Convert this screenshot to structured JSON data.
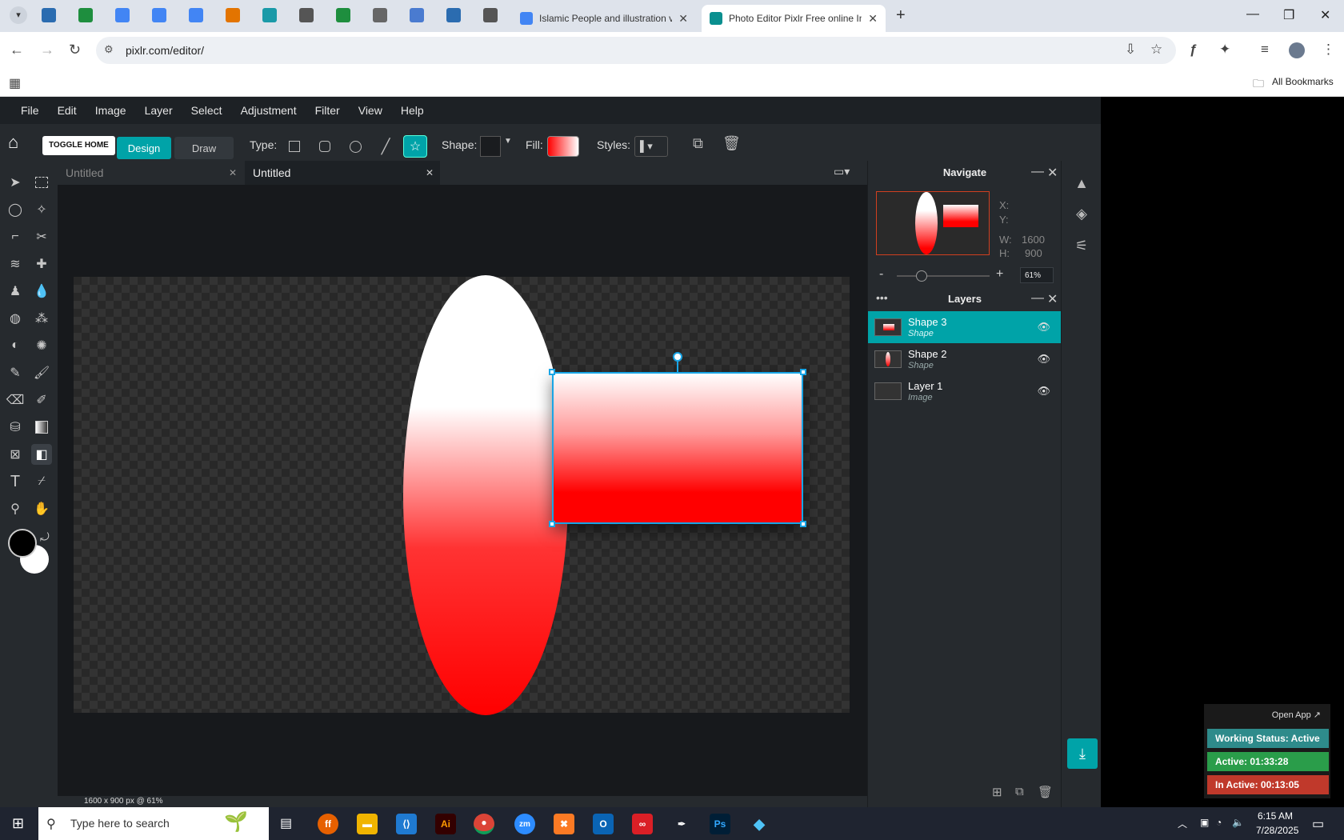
{
  "browser": {
    "pinned_tab_colors": [
      "#2b6cb0",
      "#1e8e3e",
      "#4285f4",
      "#4285f4",
      "#4285f4",
      "#e37400",
      "#1a9aa8",
      "#555555",
      "#1e8e3e",
      "#666666",
      "#4a7bd0",
      "#2b6cb0",
      "#555555"
    ],
    "tabs": [
      {
        "title": "Islamic People and illustration v",
        "active": false
      },
      {
        "title": "Photo Editor Pixlr Free online In",
        "active": true
      }
    ],
    "new_tab": "+",
    "url": "pixlr.com/editor/",
    "bookmarks_label": "All Bookmarks"
  },
  "pixlr": {
    "menu": [
      "File",
      "Edit",
      "Image",
      "Layer",
      "Select",
      "Adjustment",
      "Filter",
      "View",
      "Help"
    ],
    "tooltip": "TOGGLE HOME",
    "mode_buttons": {
      "design": "Design",
      "draw": "Draw"
    },
    "type_label": "Type:",
    "shape_label": "Shape:",
    "fill_label": "Fill:",
    "styles_label": "Styles:",
    "doc_tabs": [
      {
        "title": "Untitled",
        "active": false
      },
      {
        "title": "Untitled",
        "active": true
      }
    ],
    "status": "1600 x 900 px @ 61%",
    "navigate": {
      "title": "Navigate",
      "x_label": "X:",
      "y_label": "Y:",
      "w_label": "W:",
      "w_value": "1600",
      "h_label": "H:",
      "h_value": "900",
      "zoom_minus": "-",
      "zoom_plus": "+",
      "zoom": "61%",
      "zoom_level": 0.61
    },
    "layers": {
      "title": "Layers",
      "items": [
        {
          "name": "Shape 3",
          "type": "Shape",
          "selected": true
        },
        {
          "name": "Shape 2",
          "type": "Shape",
          "selected": false
        },
        {
          "name": "Layer 1",
          "type": "Image",
          "selected": false
        }
      ]
    },
    "accent": "#00a3a8"
  },
  "widget": {
    "open_app": "Open App ↗",
    "working_status": "Working Status: Active",
    "active": "Active: 01:33:28",
    "inactive": "In Active: 00:13:05",
    "colors": {
      "status": "#2e8b8b",
      "active": "#2a9d4a",
      "inactive": "#c0392b"
    }
  },
  "taskbar": {
    "search_placeholder": "Type here to search",
    "apps": [
      "file-explorer",
      "firefox",
      "folder",
      "vscode",
      "illustrator",
      "chrome",
      "zoom",
      "xampp",
      "outlook",
      "creative-cloud",
      "pen",
      "photoshop",
      "app"
    ],
    "time": "6:15 AM",
    "date": "7/28/2025"
  }
}
